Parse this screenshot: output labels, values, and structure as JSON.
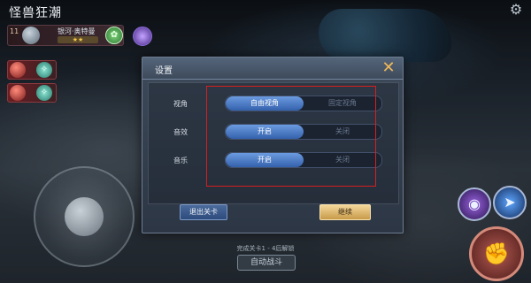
{
  "hud": {
    "title": "怪兽狂潮",
    "enemy": {
      "level": "11",
      "name": "银河·奥特曼",
      "stars": "★★"
    },
    "wave_text": "完成关卡1 - 4后解锁",
    "auto_battle_label": "自动战斗"
  },
  "settings_dialog": {
    "title": "设置",
    "close_glyph": "✕",
    "rows": [
      {
        "label": "视角",
        "options": [
          "自由视角",
          "固定视角"
        ],
        "selected": 0
      },
      {
        "label": "音效",
        "options": [
          "开启",
          "关闭"
        ],
        "selected": 0
      },
      {
        "label": "音乐",
        "options": [
          "开启",
          "关闭"
        ],
        "selected": 0
      }
    ],
    "exit_label": "退出关卡",
    "continue_label": "继续"
  },
  "icons": {
    "settings": "gear-icon",
    "close": "close-icon",
    "attack": "fist-icon",
    "skill_one": "purple-swirl-icon",
    "skill_two": "blue-arrow-icon"
  },
  "colors": {
    "active_toggle": "#3461ac",
    "highlight": "#d61f1f",
    "continue_button": "#c89a4a",
    "close_x": "#f0b85a"
  }
}
